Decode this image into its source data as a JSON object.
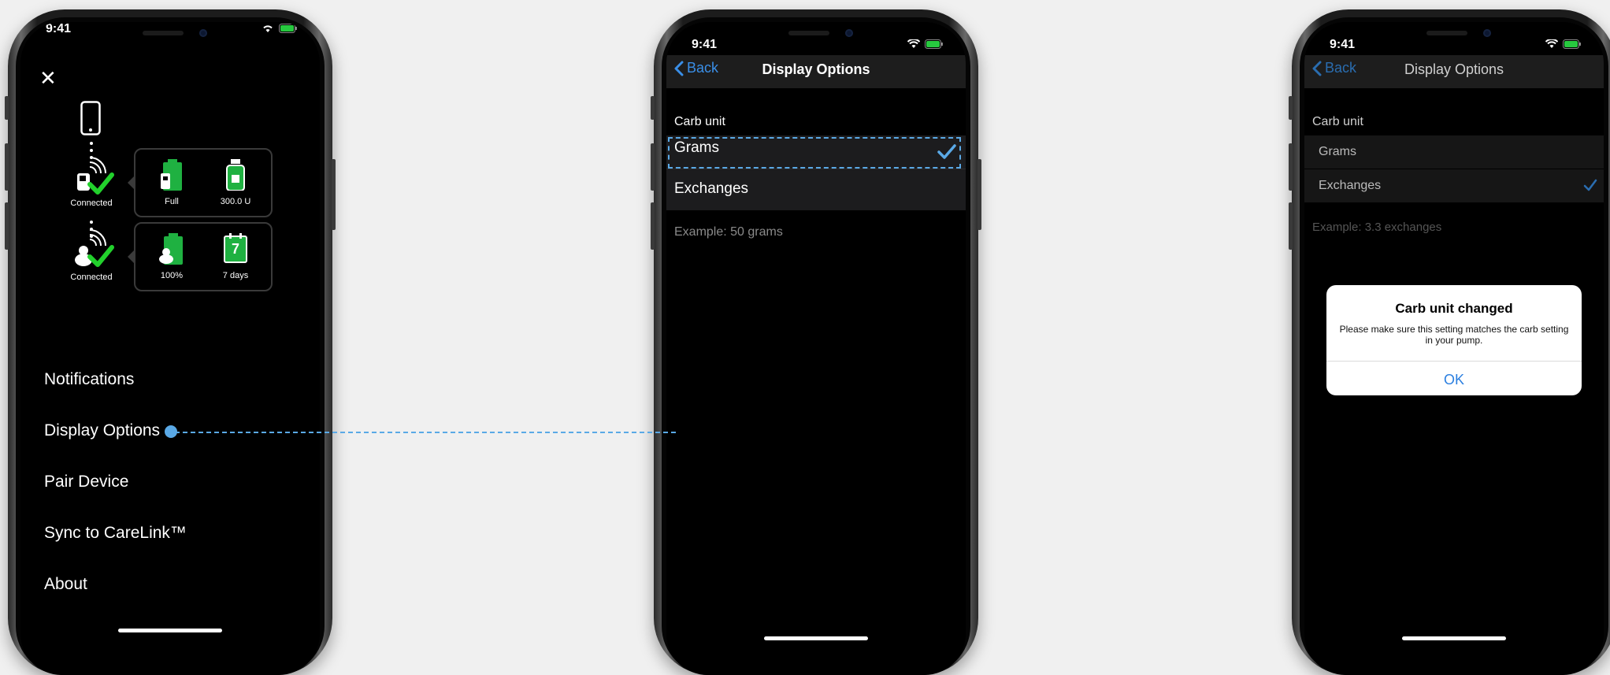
{
  "colors": {
    "accent": "#3a8fe8",
    "selection": "#5aa9e6",
    "success": "#27c93f",
    "battery_green": "#1fb141"
  },
  "status_bar": {
    "time": "9:41"
  },
  "phone1": {
    "device1": {
      "status": "Connected",
      "battery_label": "Full",
      "reservoir_label": "300.0 U"
    },
    "device2": {
      "status": "Connected",
      "battery_label": "100%",
      "sensor_label": "7 days",
      "sensor_days": "7"
    },
    "menu": [
      {
        "label": "Notifications"
      },
      {
        "label": "Display Options"
      },
      {
        "label": "Pair Device"
      },
      {
        "label": "Sync to CareLink™"
      },
      {
        "label": "About"
      }
    ]
  },
  "phone2": {
    "back_label": "Back",
    "title": "Display Options",
    "section_label": "Carb unit",
    "options": [
      {
        "label": "Grams",
        "selected": true
      },
      {
        "label": "Exchanges",
        "selected": false
      }
    ],
    "example": "Example: 50 grams"
  },
  "phone3": {
    "back_label": "Back",
    "title": "Display Options",
    "section_label": "Carb unit",
    "options": [
      {
        "label": "Grams",
        "selected": false
      },
      {
        "label": "Exchanges",
        "selected": true
      }
    ],
    "example": "Example: 3.3 exchanges",
    "dialog": {
      "title": "Carb unit changed",
      "message": "Please make sure this setting matches the carb setting in your pump.",
      "ok_label": "OK"
    }
  }
}
